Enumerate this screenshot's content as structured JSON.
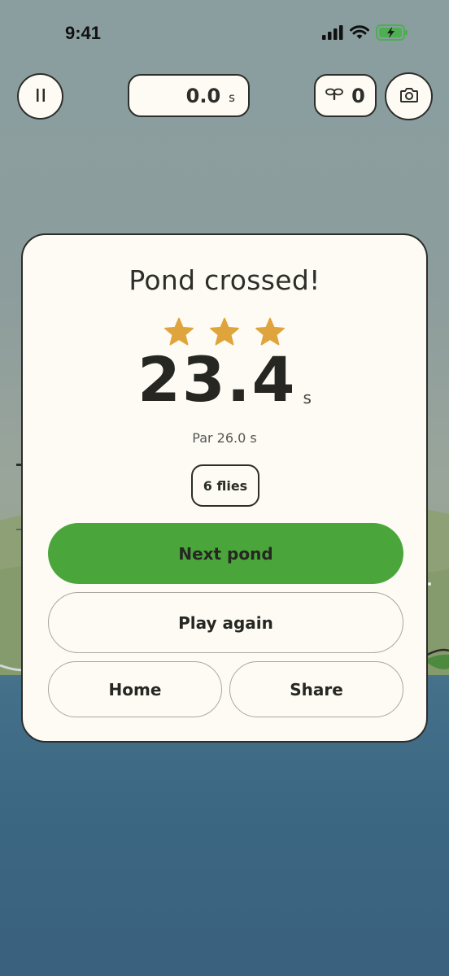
{
  "status_bar": {
    "time": "9:41"
  },
  "hud": {
    "timer_value": "0.0",
    "timer_unit": "s",
    "flies_count": "0"
  },
  "result": {
    "title": "Pond crossed!",
    "stars_earned": 3,
    "stars_total": 3,
    "time_value": "23.4",
    "time_unit": "s",
    "par_text": "Par 26.0 s",
    "flies_text": "6 flies"
  },
  "buttons": {
    "next": "Next pond",
    "again": "Play again",
    "home": "Home",
    "share": "Share"
  },
  "colors": {
    "star": "#e0a43c",
    "primary_button": "#4aa63b",
    "card": "#fdfbf4",
    "ink": "#2d2d29",
    "battery": "#4caf50",
    "water": "#3b6682"
  },
  "icons": {
    "pause": "pause-icon",
    "fly": "fly-icon",
    "camera": "camera-icon",
    "star": "star-icon"
  }
}
